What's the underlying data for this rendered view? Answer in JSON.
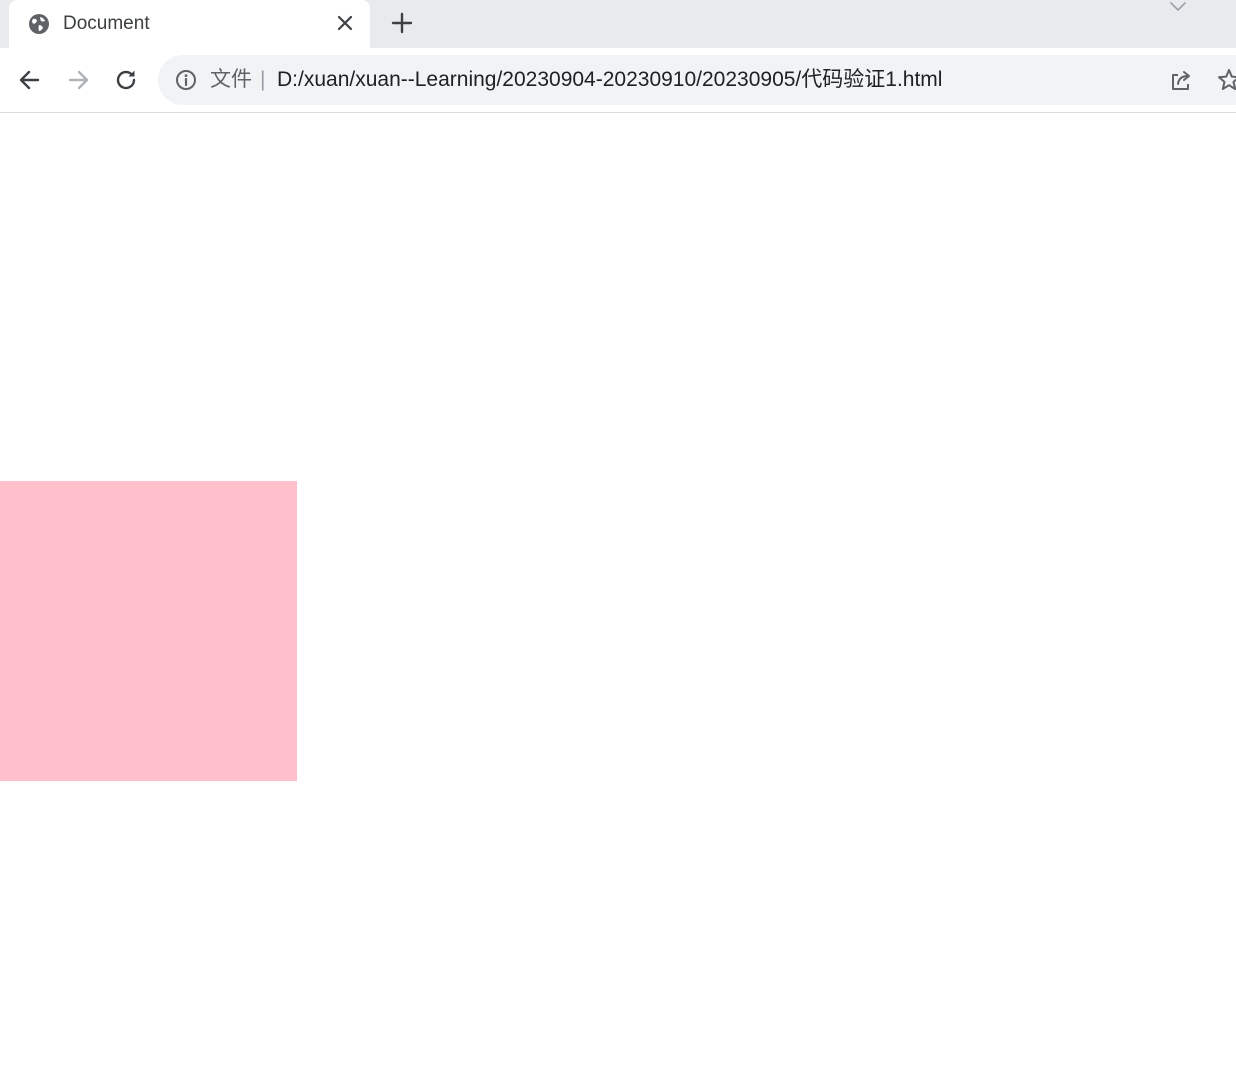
{
  "tab": {
    "title": "Document",
    "favicon_icon": "globe-icon",
    "close_icon": "close-icon"
  },
  "tabstrip": {
    "new_tab_icon": "plus-icon",
    "tab_search_icon": "chevron-down-icon"
  },
  "toolbar": {
    "back_icon": "arrow-left-icon",
    "forward_icon": "arrow-right-icon",
    "forward_enabled": false,
    "reload_icon": "reload-icon",
    "share_icon": "share-icon",
    "bookmark_icon": "star-icon"
  },
  "omnibox": {
    "info_icon": "info-icon",
    "scheme_label": "文件",
    "separator": "|",
    "url": "D:/xuan/xuan--Learning/20230904-20230910/20230905/代码验证1.html"
  },
  "page": {
    "background_color": "#ffffff",
    "box_color": "#ffc0cb"
  }
}
